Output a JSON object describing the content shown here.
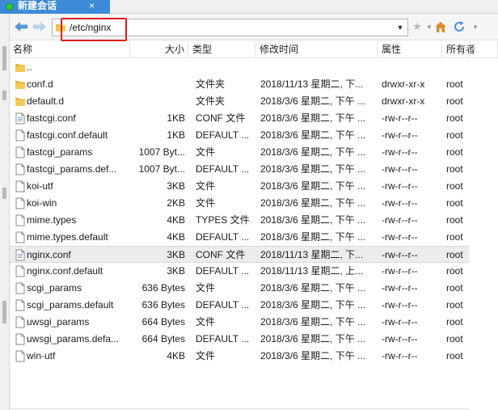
{
  "tab": {
    "title": "新建会话",
    "close": "×"
  },
  "address": {
    "path": "/etc/nginx",
    "dropdown": "▼"
  },
  "toolbar": {
    "star": "★"
  },
  "columns": [
    {
      "label": "名称"
    },
    {
      "label": "大小"
    },
    {
      "label": "类型"
    },
    {
      "label": "修改时间"
    },
    {
      "label": "属性"
    },
    {
      "label": "所有者"
    }
  ],
  "files": [
    {
      "name": "..",
      "size": "",
      "type": "",
      "mtime": "",
      "perm": "",
      "owner": "",
      "icon": "folder-icon"
    },
    {
      "name": "conf.d",
      "size": "",
      "type": "文件夹",
      "mtime": "2018/11/13 星期二, 下...",
      "perm": "drwxr-xr-x",
      "owner": "root",
      "icon": "folder-icon"
    },
    {
      "name": "default.d",
      "size": "",
      "type": "文件夹",
      "mtime": "2018/3/6 星期二, 下午 ...",
      "perm": "drwxr-xr-x",
      "owner": "root",
      "icon": "folder-icon"
    },
    {
      "name": "fastcgi.conf",
      "size": "1KB",
      "type": "CONF 文件",
      "mtime": "2018/3/6 星期二, 下午 ...",
      "perm": "-rw-r--r--",
      "owner": "root",
      "icon": "config-file-icon"
    },
    {
      "name": "fastcgi.conf.default",
      "size": "1KB",
      "type": "DEFAULT ...",
      "mtime": "2018/3/6 星期二, 下午 ...",
      "perm": "-rw-r--r--",
      "owner": "root",
      "icon": "file-icon"
    },
    {
      "name": "fastcgi_params",
      "size": "1007 Byt...",
      "type": "文件",
      "mtime": "2018/3/6 星期二, 下午 ...",
      "perm": "-rw-r--r--",
      "owner": "root",
      "icon": "file-icon"
    },
    {
      "name": "fastcgi_params.def...",
      "size": "1007 Byt...",
      "type": "DEFAULT ...",
      "mtime": "2018/3/6 星期二, 下午 ...",
      "perm": "-rw-r--r--",
      "owner": "root",
      "icon": "file-icon"
    },
    {
      "name": "koi-utf",
      "size": "3KB",
      "type": "文件",
      "mtime": "2018/3/6 星期二, 下午 ...",
      "perm": "-rw-r--r--",
      "owner": "root",
      "icon": "file-icon"
    },
    {
      "name": "koi-win",
      "size": "2KB",
      "type": "文件",
      "mtime": "2018/3/6 星期二, 下午 ...",
      "perm": "-rw-r--r--",
      "owner": "root",
      "icon": "file-icon"
    },
    {
      "name": "mime.types",
      "size": "4KB",
      "type": "TYPES 文件",
      "mtime": "2018/3/6 星期二, 下午 ...",
      "perm": "-rw-r--r--",
      "owner": "root",
      "icon": "file-icon"
    },
    {
      "name": "mime.types.default",
      "size": "4KB",
      "type": "DEFAULT ...",
      "mtime": "2018/3/6 星期二, 下午 ...",
      "perm": "-rw-r--r--",
      "owner": "root",
      "icon": "file-icon"
    },
    {
      "name": "nginx.conf",
      "size": "3KB",
      "type": "CONF 文件",
      "mtime": "2018/11/13 星期二, 下...",
      "perm": "-rw-r--r--",
      "owner": "root",
      "icon": "config-file-icon"
    },
    {
      "name": "nginx.conf.default",
      "size": "3KB",
      "type": "DEFAULT ...",
      "mtime": "2018/11/13 星期二, 上...",
      "perm": "-rw-r--r--",
      "owner": "root",
      "icon": "file-icon"
    },
    {
      "name": "scgi_params",
      "size": "636 Bytes",
      "type": "文件",
      "mtime": "2018/3/6 星期二, 下午 ...",
      "perm": "-rw-r--r--",
      "owner": "root",
      "icon": "file-icon"
    },
    {
      "name": "scgi_params.default",
      "size": "636 Bytes",
      "type": "DEFAULT ...",
      "mtime": "2018/3/6 星期二, 下午 ...",
      "perm": "-rw-r--r--",
      "owner": "root",
      "icon": "file-icon"
    },
    {
      "name": "uwsgi_params",
      "size": "664 Bytes",
      "type": "文件",
      "mtime": "2018/3/6 星期二, 下午 ...",
      "perm": "-rw-r--r--",
      "owner": "root",
      "icon": "file-icon"
    },
    {
      "name": "uwsgi_params.defa...",
      "size": "664 Bytes",
      "type": "DEFAULT ...",
      "mtime": "2018/3/6 星期二, 下午 ...",
      "perm": "-rw-r--r--",
      "owner": "root",
      "icon": "file-icon"
    },
    {
      "name": "win-utf",
      "size": "4KB",
      "type": "文件",
      "mtime": "2018/3/6 星期二, 下午 ...",
      "perm": "-rw-r--r--",
      "owner": "root",
      "icon": "file-icon"
    }
  ],
  "selected_row": 11,
  "colors": {
    "tab_bg": "#3c8ad8",
    "tab_dot": "#2fd12f",
    "highlight_box": "#e21b1b",
    "folder": "#e8b53c",
    "nav_arrow": "#5b95d6",
    "refresh": "#4a90d9",
    "home": "#d98c2b"
  }
}
